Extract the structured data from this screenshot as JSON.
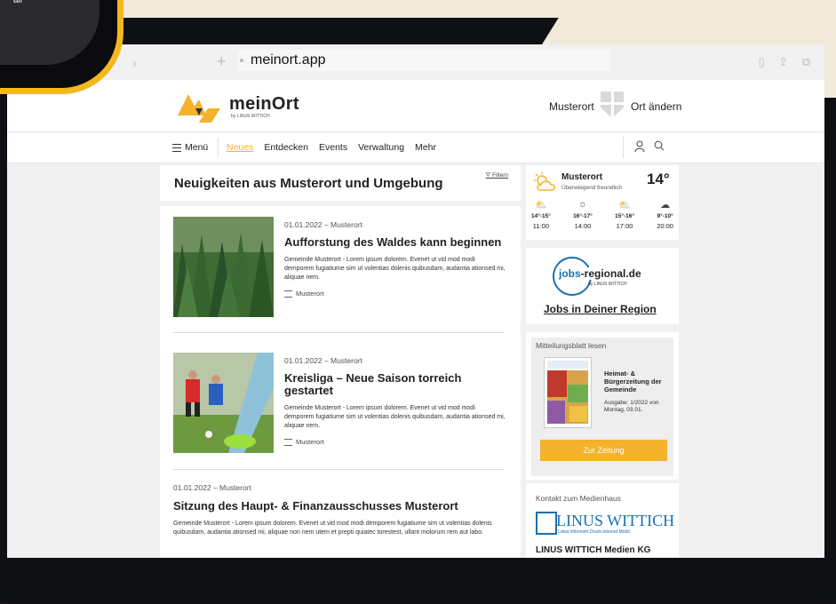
{
  "phone": {
    "partial_text": "all"
  },
  "browser": {
    "url": "meinort.app"
  },
  "header": {
    "brand": "meinOrt",
    "brand_sub": "by LINUS WITTICH",
    "place": "Musterort",
    "change_place": "Ort ändern"
  },
  "nav": {
    "menu": "Menü",
    "items": [
      {
        "label": "Neues",
        "active": true
      },
      {
        "label": "Entdecken"
      },
      {
        "label": "Events"
      },
      {
        "label": "Verwaltung"
      },
      {
        "label": "Mehr"
      }
    ]
  },
  "news": {
    "headline": "Neuigkeiten aus Musterort und Umgebung",
    "filter": "Filtern",
    "articles": [
      {
        "meta": "01.01.2022 – Musterort",
        "title": "Aufforstung des Waldes kann beginnen",
        "text": "Gemeinde Musterort - Lorem ipsum dolorem. Evenet ut vid mod modi demporem fugiatiume sim ut volentias dolenis quibusdam, audantia ationsed mi, aliquae nem.",
        "tag": "Musterort"
      },
      {
        "meta": "01.01.2022 – Musterort",
        "title": "Kreisliga – Neue Saison torreich gestartet",
        "text": "Gemeinde Musterort - Lorem ipsum dolorem. Evenet ut vid mod modi demporem fugiatiume sim ut volentias dolenis quibusdam, audantia ationsed mi, aliquae nem.",
        "tag": "Musterort"
      },
      {
        "meta": "01.01.2022 – Musterort",
        "title": "Sitzung des Haupt- & Finanzausschusses Musterort",
        "text": "Gemeinde Musterort - Lorem ipsum dolorem. Evenet ut vid mod modi demporem fugiatiume sim ut volentias dolenis quibusdam, audantia ationsed mi, aliquae non nem utem et prepti quiatec torestest, ullant molorum rem aut labo."
      }
    ]
  },
  "weather": {
    "city": "Musterort",
    "description": "Überwiegend freundlich",
    "temperature": "14°",
    "forecast": [
      {
        "icon": "cloud-sun-icon",
        "temps": "14°-15°",
        "time": "11:00"
      },
      {
        "icon": "sun-icon",
        "temps": "16°-17°",
        "time": "14:00"
      },
      {
        "icon": "cloud-sun-icon",
        "temps": "15°-16°",
        "time": "17:00"
      },
      {
        "icon": "cloud-icon",
        "temps": "9°-10°",
        "time": "20:00"
      }
    ]
  },
  "jobs": {
    "name_prefix": "jobs",
    "name_suffix": "-regional.de",
    "sub": "by LINUS WITTICH",
    "link": "Jobs in Deiner Region"
  },
  "mitteilungsblatt": {
    "title": "Mitteilungsblatt lesen",
    "heading": "Heimat- & Bürgerzeitung der Gemeinde",
    "issue": "Ausgabe: 1/2022 von Montag, 03.01.",
    "button": "Zur Zeitung"
  },
  "contact": {
    "title": "Kontakt zum Medienhaus",
    "logo_text": "LINUS WITTICH",
    "logo_tagline": "Lokal.Informiert.Druck.Internet.Mobil.",
    "company": "LINUS WITTICH Medien KG"
  },
  "colors": {
    "accent": "#f5b22d",
    "blue": "#1a6fb3",
    "device_ring": "#f4b81c"
  }
}
